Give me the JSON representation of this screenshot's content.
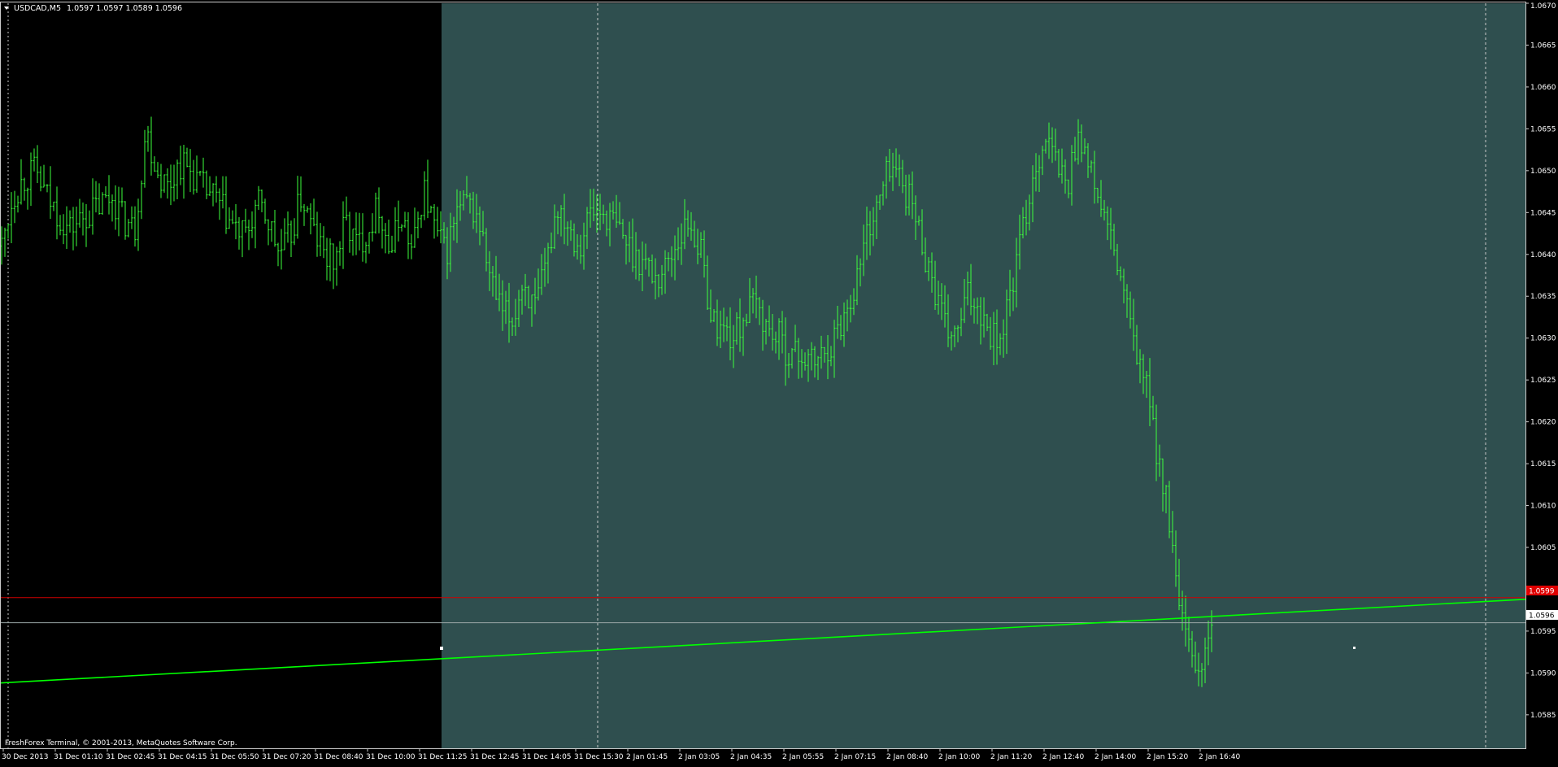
{
  "header": {
    "symbol_timeframe": "USDCAD,M5",
    "ohlc": "1.0597 1.0597 1.0589 1.0596"
  },
  "footer": {
    "copyright": "FreshForex Terminal, © 2001-2013, MetaQuotes Software Corp."
  },
  "colors": {
    "background": "#000000",
    "highlight_zone": "#2f4f4f",
    "bars": "#3cff3c",
    "trendline": "#00ff00",
    "red_level": "#d00000",
    "bid_line": "#9aa6a6",
    "axis_text": "#ffffff",
    "price_tag_red": "#e00000"
  },
  "chart_data": {
    "type": "line",
    "instrument": "USDCAD",
    "timeframe": "M5",
    "ylim": [
      1.0581,
      1.067
    ],
    "price_ticks": [
      "1.0670",
      "1.0665",
      "1.0660",
      "1.0655",
      "1.0650",
      "1.0645",
      "1.0640",
      "1.0635",
      "1.0630",
      "1.0625",
      "1.0620",
      "1.0615",
      "1.0610",
      "1.0605",
      "1.0600",
      "1.0595",
      "1.0590",
      "1.0585"
    ],
    "time_ticks": [
      "30 Dec 2013",
      "31 Dec 01:10",
      "31 Dec 02:45",
      "31 Dec 04:15",
      "31 Dec 05:50",
      "31 Dec 07:20",
      "31 Dec 08:40",
      "31 Dec 10:00",
      "31 Dec 11:25",
      "31 Dec 12:45",
      "31 Dec 14:05",
      "31 Dec 15:30",
      "2 Jan 01:45",
      "2 Jan 03:05",
      "2 Jan 04:35",
      "2 Jan 05:55",
      "2 Jan 07:15",
      "2 Jan 08:40",
      "2 Jan 10:00",
      "2 Jan 11:20",
      "2 Jan 12:40",
      "2 Jan 14:00",
      "2 Jan 15:20",
      "2 Jan 16:40"
    ],
    "approx_close_path": [
      1.0641,
      1.0647,
      1.0649,
      1.065,
      1.0647,
      1.0645,
      1.0643,
      1.0644,
      1.0645,
      1.0646,
      1.0647,
      1.0644,
      1.0643,
      1.0655,
      1.065,
      1.0648,
      1.0651,
      1.065,
      1.0648,
      1.0647,
      1.0645,
      1.0643,
      1.0642,
      1.0646,
      1.0644,
      1.064,
      1.0642,
      1.0647,
      1.0643,
      1.064,
      1.0639,
      1.0644,
      1.0641,
      1.0643,
      1.0646,
      1.064,
      1.0645,
      1.064,
      1.0648,
      1.0643,
      1.064,
      1.0645,
      1.0646,
      1.0644,
      1.0637,
      1.0633,
      1.0632,
      1.0637,
      1.0633,
      1.0638,
      1.0646,
      1.0644,
      1.0641,
      1.0645,
      1.0645,
      1.0644,
      1.0642,
      1.064,
      1.0639,
      1.0637,
      1.0639,
      1.0642,
      1.0644,
      1.064,
      1.0632,
      1.0631,
      1.063,
      1.0633,
      1.0634,
      1.0631,
      1.063,
      1.0628,
      1.0628,
      1.0627,
      1.0628,
      1.063,
      1.0633,
      1.0637,
      1.0643,
      1.0646,
      1.0651,
      1.0649,
      1.0646,
      1.0641,
      1.0636,
      1.0631,
      1.063,
      1.0635,
      1.0634,
      1.0631,
      1.063,
      1.0636,
      1.0643,
      1.065,
      1.0654,
      1.0651,
      1.0648,
      1.0655,
      1.065,
      1.0646,
      1.0641,
      1.0636,
      1.0629,
      1.0625,
      1.0617,
      1.061,
      1.0598,
      1.0592,
      1.059,
      1.0596
    ],
    "current_price": "1.0596",
    "red_level_price": "1.0599",
    "trendline": {
      "from": {
        "time": "30 Dec 2013",
        "price": 1.05888
      },
      "to": {
        "price": 1.05988
      }
    },
    "highlight_zone_start": "31 Dec 11:25",
    "vertical_dotted_lines": [
      "31 Dec 15:30"
    ],
    "grid": false
  }
}
